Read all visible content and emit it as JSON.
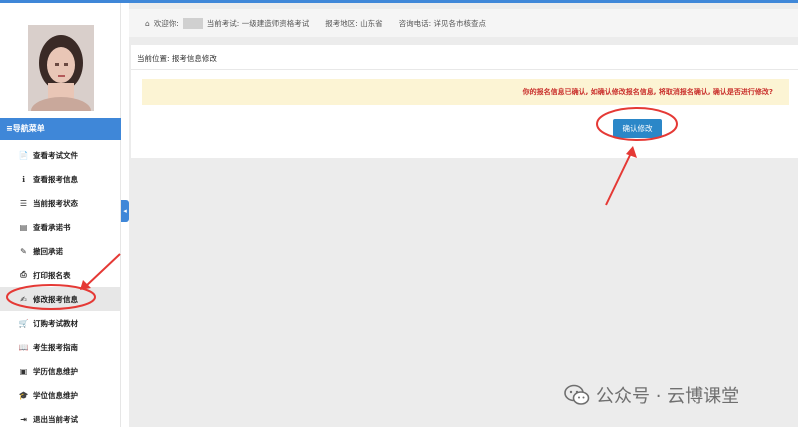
{
  "header": {
    "welcome_label": "欢迎你:",
    "exam_label": "当前考试: 一级建造师资格考试",
    "region_label": "报考地区: 山东省",
    "phone_label": "咨询电话: 详见各市核查点"
  },
  "sidebar": {
    "menu_title": "≡导航菜单",
    "items": [
      {
        "icon": "📄",
        "label": "查看考试文件"
      },
      {
        "icon": "ℹ",
        "label": "查看报考信息"
      },
      {
        "icon": "☰",
        "label": "当前报考状态"
      },
      {
        "icon": "▤",
        "label": "查看承诺书"
      },
      {
        "icon": "✎",
        "label": "撤回承诺"
      },
      {
        "icon": "⎙",
        "label": "打印报名表"
      },
      {
        "icon": "✍",
        "label": "修改报考信息"
      },
      {
        "icon": "🛒",
        "label": "订购考试教材"
      },
      {
        "icon": "📖",
        "label": "考生报考指南"
      },
      {
        "icon": "▣",
        "label": "学历信息维护"
      },
      {
        "icon": "🎓",
        "label": "学位信息维护"
      },
      {
        "icon": "⇥",
        "label": "退出当前考试"
      }
    ],
    "active_index": 6
  },
  "main": {
    "breadcrumb": "当前位置: 报考信息修改",
    "notice": "你的报名信息已确认, 如确认修改报名信息, 将取消报名确认, 确认是否进行修改?",
    "confirm_button": "确认修改"
  },
  "watermark": {
    "text": "公众号 · 云博课堂"
  },
  "colors": {
    "accent": "#3f87d8",
    "button": "#2b87c8",
    "notice_bg": "#fcf4d4",
    "notice_text": "#c9302c",
    "annotation": "#e53935"
  }
}
